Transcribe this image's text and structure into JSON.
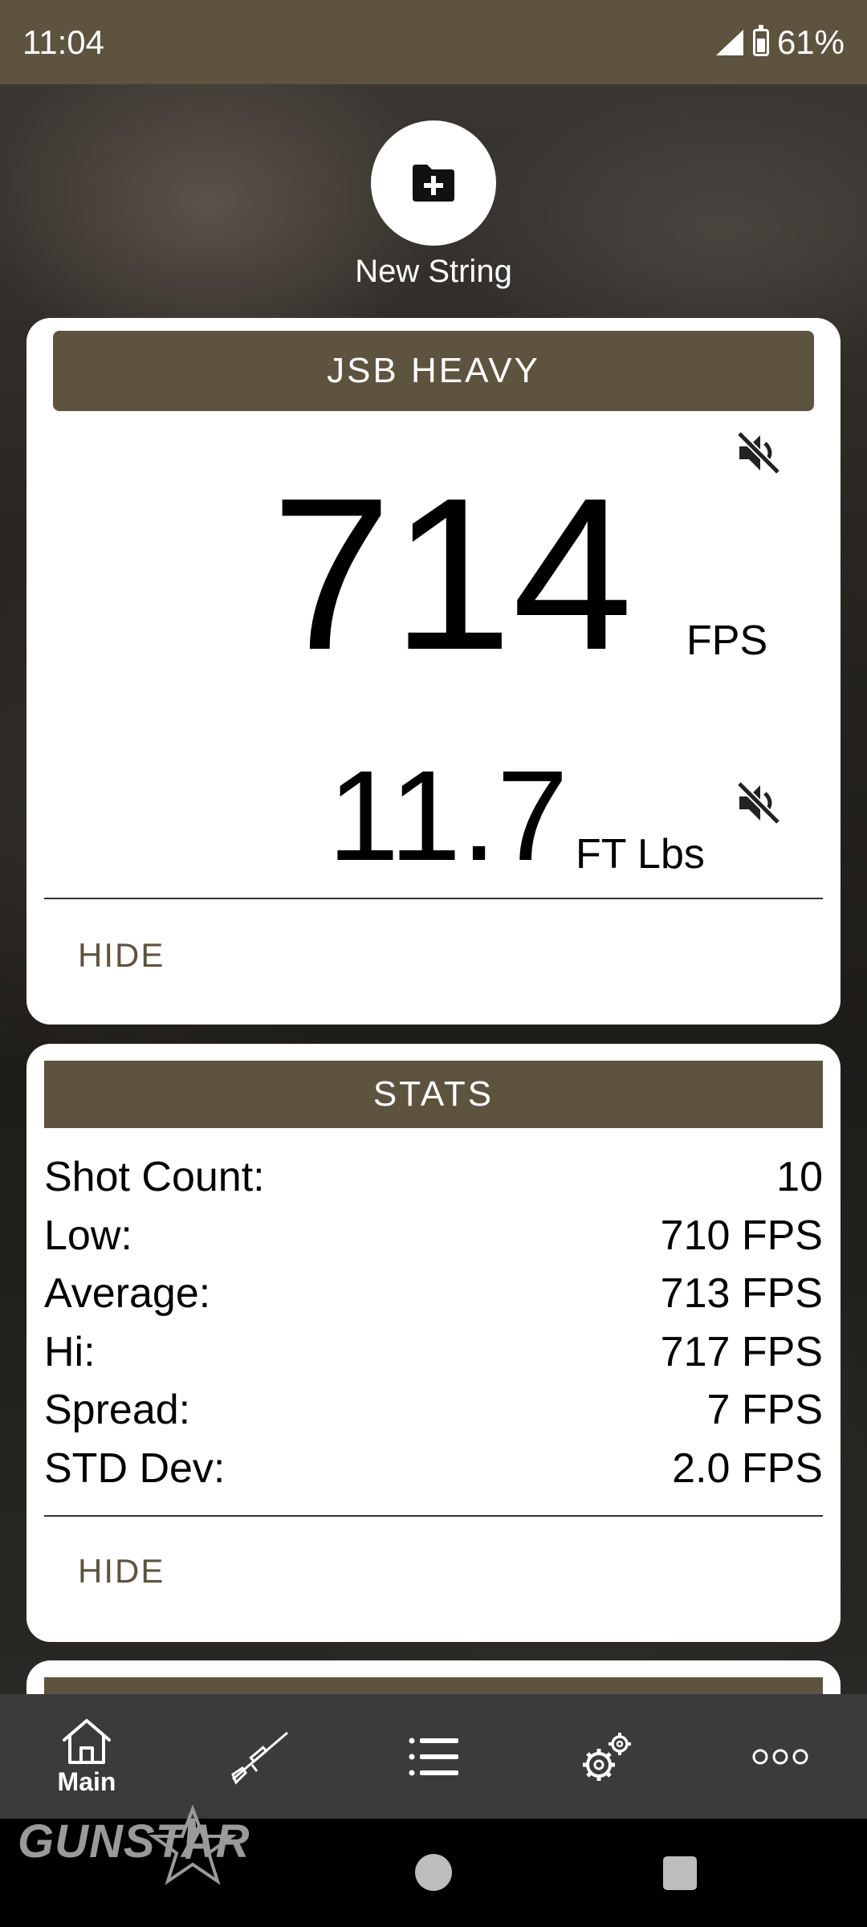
{
  "status_bar": {
    "time": "11:04",
    "battery": "61%"
  },
  "new_string": {
    "label": "New String",
    "icon": "folder-plus-icon"
  },
  "main_card": {
    "title": "JSB HEAVY",
    "velocity": "714",
    "velocity_unit": "FPS",
    "energy": "11.7",
    "energy_unit": "FT Lbs",
    "hide_label": "HIDE"
  },
  "stats_card": {
    "title": "STATS",
    "rows": [
      {
        "label": "Shot Count:",
        "value": "10"
      },
      {
        "label": "Low:",
        "value": "710 FPS"
      },
      {
        "label": "Average:",
        "value": "713 FPS"
      },
      {
        "label": "Hi:",
        "value": "717 FPS"
      },
      {
        "label": "Spread:",
        "value": "7 FPS"
      },
      {
        "label": "STD Dev:",
        "value": "2.0 FPS"
      }
    ],
    "hide_label": "HIDE"
  },
  "bottom_nav": {
    "items": [
      {
        "label": "Main",
        "icon": "home-icon"
      },
      {
        "label": "",
        "icon": "rifle-icon"
      },
      {
        "label": "",
        "icon": "list-icon"
      },
      {
        "label": "",
        "icon": "gears-icon"
      },
      {
        "label": "",
        "icon": "more-icon"
      }
    ]
  },
  "brand": {
    "logo_text": "GUNSTAR"
  },
  "colors": {
    "accent": "#5e533f",
    "nav_bg": "#3b3b3b",
    "card_bg": "#ffffff"
  }
}
